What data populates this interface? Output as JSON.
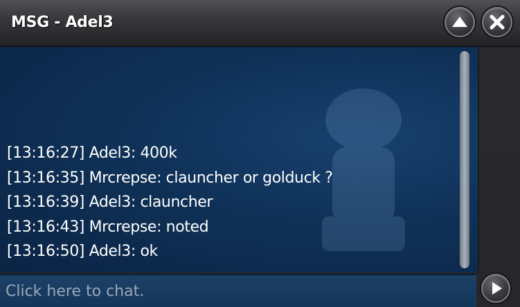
{
  "window": {
    "title": "MSG - Adel3"
  },
  "title_buttons": {
    "minimize_icon": "chevron-up-icon",
    "close_icon": "close-icon"
  },
  "chat": {
    "messages": [
      "[13:16:27] Adel3: 400k",
      "[13:16:35] Mrcrepse: clauncher or golduck ?",
      "[13:16:39] Adel3: clauncher",
      "[13:16:43] Mrcrepse: noted",
      "[13:16:50] Adel3: ok"
    ]
  },
  "input": {
    "placeholder": "Click here to chat.",
    "value": "",
    "send_icon": "play-arrow-icon"
  },
  "colors": {
    "chat_background": "#0f3157",
    "titlebar": "#38383c",
    "text": "#ffffff"
  }
}
